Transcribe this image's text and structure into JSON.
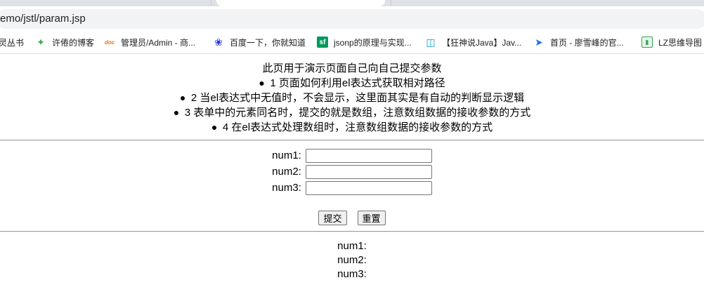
{
  "browser": {
    "url": "emo/jstl/param.jsp",
    "bookmarks": [
      {
        "label": "灵丛书",
        "icon": "none"
      },
      {
        "label": "许倦的博客",
        "icon": "leaf-icon"
      },
      {
        "label": "管理员/Admin - 商...",
        "icon": "doc-icon"
      },
      {
        "label": "百度一下，你就知道",
        "icon": "baidu-paw-icon"
      },
      {
        "label": "jsonp的原理与实现...",
        "icon": "segmentfault-icon"
      },
      {
        "label": "【狂神说Java】Jav...",
        "icon": "bilibili-tv-icon"
      },
      {
        "label": "首页 - 廖雪峰的官...",
        "icon": "rocket-icon"
      },
      {
        "label": "LZ思维导图",
        "icon": "book-icon"
      }
    ]
  },
  "page": {
    "intro_title": "此页用于演示页面自己向自己提交参数",
    "intro_items": [
      "1 页面如何利用el表达式获取相对路径",
      "2 当el表达式中无值时，不会显示，这里面其实是有自动的判断显示逻辑",
      "3 表单中的元素同名时，提交的就是数组，注意数组数据的接收参数的方式",
      "4 在el表达式处理数组时，注意数组数据的接收参数的方式"
    ],
    "form": {
      "fields": [
        {
          "label": "num1:",
          "value": ""
        },
        {
          "label": "num2:",
          "value": ""
        },
        {
          "label": "num3:",
          "value": ""
        }
      ],
      "submit_label": "提交",
      "reset_label": "重置"
    },
    "results": [
      "num1:",
      "num2:",
      "num3:"
    ]
  }
}
